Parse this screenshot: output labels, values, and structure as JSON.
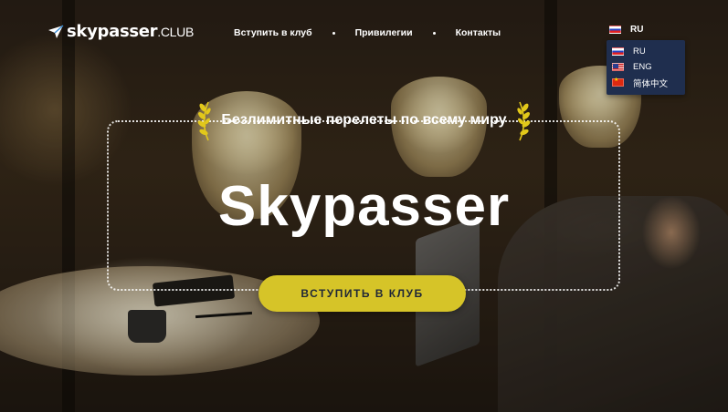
{
  "brand": {
    "name": "skypasser",
    "suffix": ".CLUB"
  },
  "nav": {
    "items": [
      {
        "label": "Вступить в клуб"
      },
      {
        "label": "Привилегии"
      },
      {
        "label": "Контакты"
      }
    ]
  },
  "language": {
    "current": "RU",
    "options": [
      {
        "code": "RU",
        "flag": "flag-ru-icon"
      },
      {
        "code": "ENG",
        "flag": "flag-us-icon"
      },
      {
        "code": "简体中文",
        "flag": "flag-cn-icon"
      }
    ]
  },
  "hero": {
    "tagline": "Безлимитные перелеты по всему миру",
    "headline": "Skypasser",
    "cta_label": "ВСТУПИТЬ В КЛУБ"
  },
  "colors": {
    "accent": "#d6c428",
    "cta_text": "#1f2737",
    "laurel": "#e2c81a",
    "dropdown_bg": "#1f2e4e"
  }
}
